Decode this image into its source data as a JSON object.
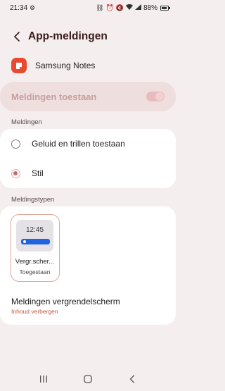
{
  "status_bar": {
    "time": "21:34",
    "battery": "88%",
    "battery_level": 0.88
  },
  "header": {
    "title": "App-meldingen",
    "back_icon": "chevron-left-icon"
  },
  "app": {
    "name": "Samsung Notes",
    "icon": "samsung-notes-icon",
    "icon_color": "#e8492f"
  },
  "allow": {
    "label": "Meldingen toestaan",
    "enabled": true
  },
  "meldingen": {
    "section_label": "Meldingen",
    "options": [
      {
        "label": "Geluid en trillen toestaan",
        "selected": false
      },
      {
        "label": "Stil",
        "selected": true
      }
    ]
  },
  "meldingstypen": {
    "section_label": "Meldingstypen",
    "tile": {
      "time": "12:45",
      "name": "Vergr.scher...",
      "status": "Toegestaan"
    },
    "lock_screen": {
      "title": "Meldingen vergrendelscherm",
      "subtitle": "Inhoud verbergen"
    }
  },
  "colors": {
    "accent": "#c4553f",
    "background": "#f5eeee"
  }
}
